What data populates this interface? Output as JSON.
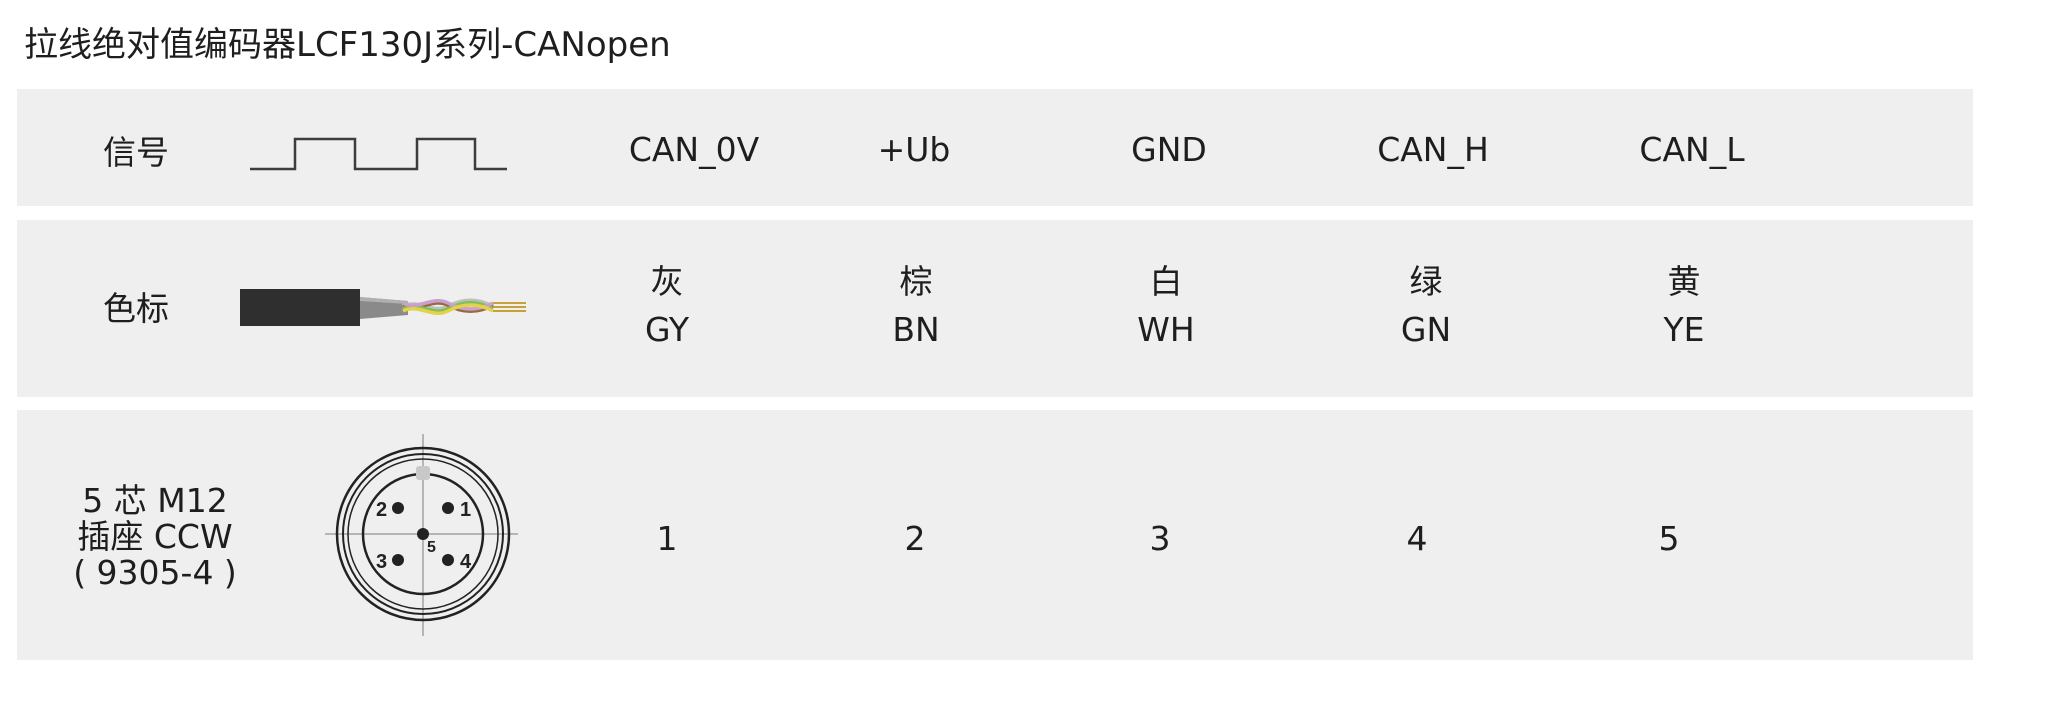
{
  "page": {
    "title": "拉线绝对值编码器LCF130J系列-CANopen"
  },
  "rows": {
    "signal_label": "信号",
    "color_label": "色标",
    "connector_label": [
      "5 芯 M12",
      "插座 CCW",
      "( 9305-4 )"
    ]
  },
  "columns": [
    {
      "signal": "CAN_0V",
      "color_cn": "灰",
      "color_abbr": "GY",
      "pin": "1"
    },
    {
      "signal": "+Ub",
      "color_cn": "棕",
      "color_abbr": "BN",
      "pin": "2"
    },
    {
      "signal": "GND",
      "color_cn": "白",
      "color_abbr": "WH",
      "pin": "3"
    },
    {
      "signal": "CAN_H",
      "color_cn": "绿",
      "color_abbr": "GN",
      "pin": "4"
    },
    {
      "signal": "CAN_L",
      "color_cn": "黄",
      "color_abbr": "YE",
      "pin": "5"
    }
  ],
  "connector_pins": [
    "1",
    "2",
    "3",
    "4",
    "5"
  ],
  "colors": {
    "band_bg": "#efefef",
    "text": "#1e1e1e",
    "cable_jacket": "#2f2f2f"
  }
}
